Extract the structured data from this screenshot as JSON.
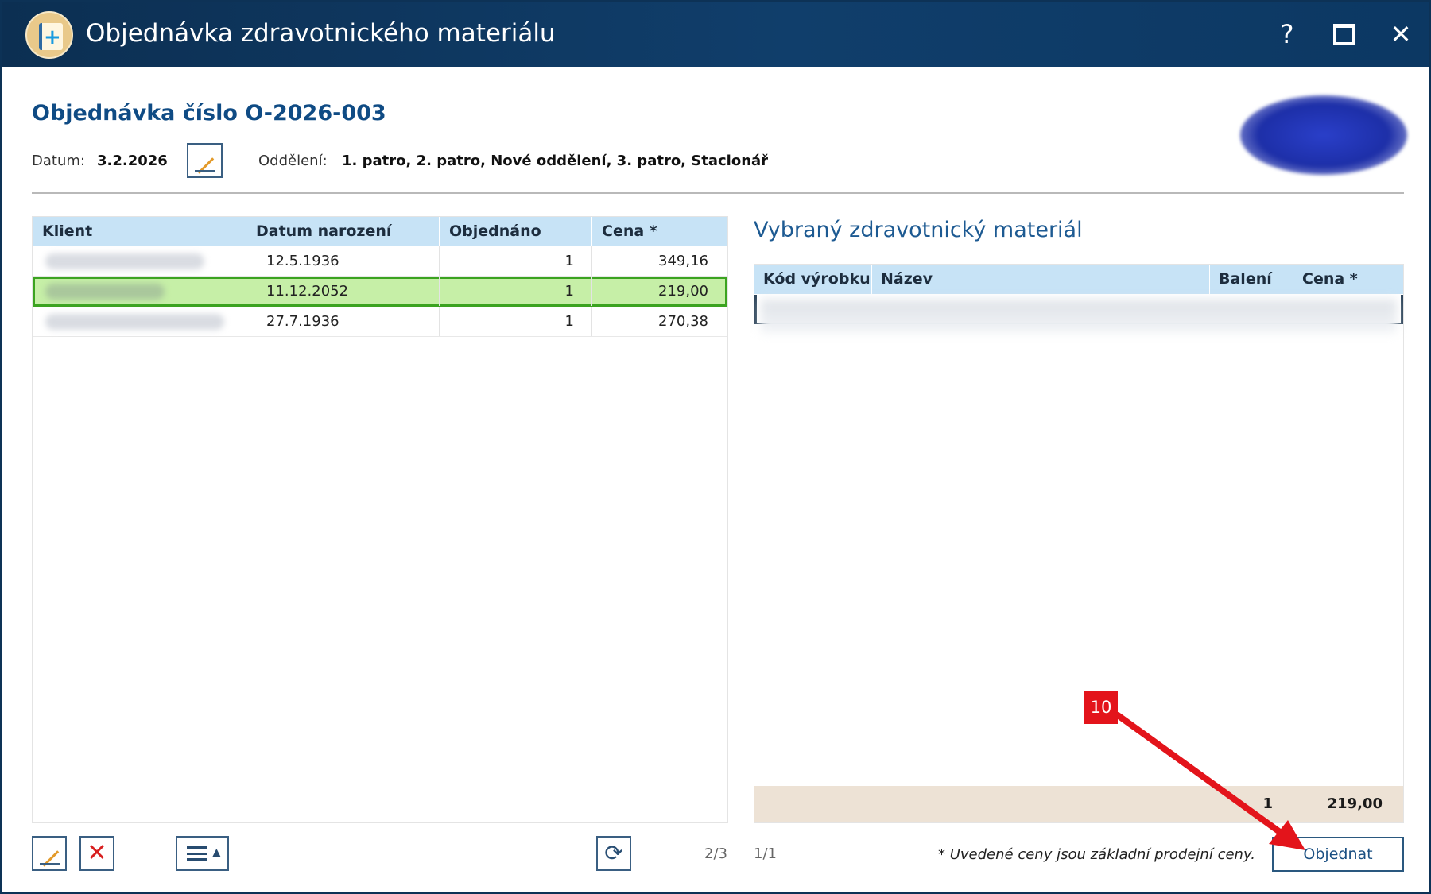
{
  "window": {
    "title": "Objednávka zdravotnického materiálu",
    "help": "?",
    "close": "✕"
  },
  "header": {
    "order_title": "Objednávka číslo O-2026-003",
    "date_label": "Datum:",
    "date_value": "3.2.2026",
    "department_label": "Oddělení:",
    "department_value": "1. patro, 2. patro, Nové oddělení, 3. patro, Stacionář"
  },
  "clients_table": {
    "columns": [
      "Klient",
      "Datum narození",
      "Objednáno",
      "Cena *"
    ],
    "rows": [
      {
        "birth": "12.5.1936",
        "ordered": "1",
        "price": "349,16",
        "selected": false
      },
      {
        "birth": "11.12.2052",
        "ordered": "1",
        "price": "219,00",
        "selected": true
      },
      {
        "birth": "27.7.1936",
        "ordered": "1",
        "price": "270,38",
        "selected": false
      }
    ],
    "pager": "2/3"
  },
  "material": {
    "title": "Vybraný zdravotnický materiál",
    "columns": [
      "Kód výrobku",
      "Název",
      "Balení",
      "Cena *"
    ],
    "footer_count": "1",
    "footer_total": "219,00",
    "pager": "1/1"
  },
  "footer": {
    "note": "* Uvedené ceny jsou základní prodejní ceny.",
    "order_button": "Objednat"
  },
  "annotation": {
    "badge": "10",
    "color": "#e3141b"
  },
  "colors": {
    "titlebar": "#0c2f52",
    "table_header": "#c7e3f6",
    "selected_row": "#c6efa7",
    "selected_border": "#3ba320",
    "accent_text": "#0f4b84"
  }
}
